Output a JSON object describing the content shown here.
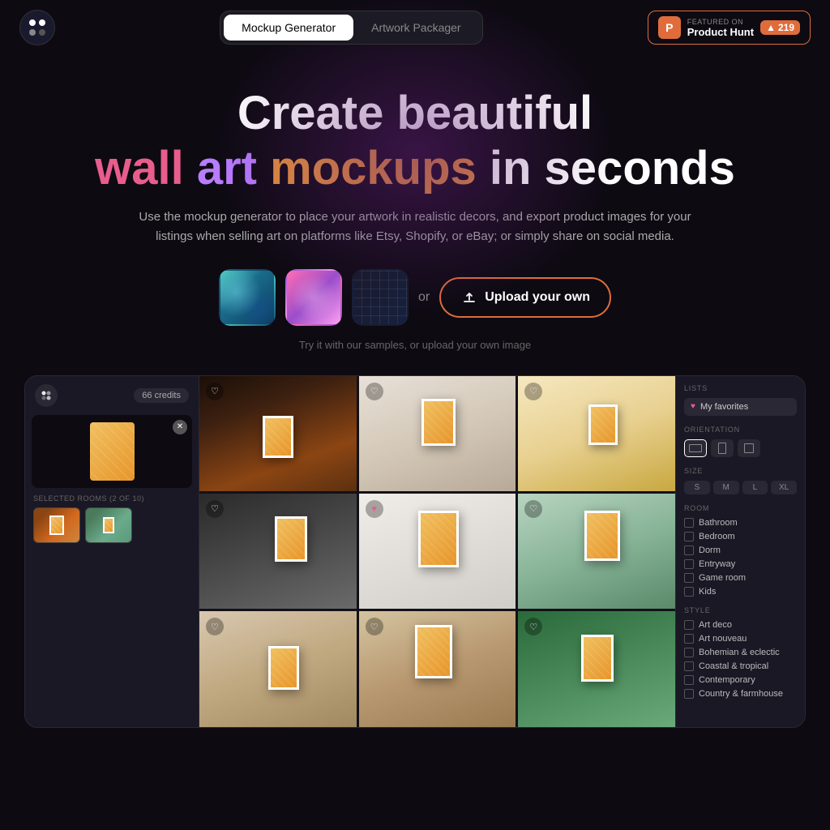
{
  "navbar": {
    "logo_alt": "App logo",
    "tab_mockup": "Mockup Generator",
    "tab_artwork": "Artwork Packager",
    "active_tab": "mockup",
    "ph_featured": "FEATURED ON",
    "ph_name": "Product Hunt",
    "ph_count": "219",
    "ph_arrow": "▲"
  },
  "hero": {
    "title_line1": "Create beautiful",
    "word_wall": "wall",
    "word_art": "art",
    "word_mockups": "mockups",
    "word_in": "in",
    "word_seconds": "seconds",
    "subtitle": "Use the mockup generator to place your artwork in realistic decors, and export product images for your listings when selling art on platforms like Etsy, Shopify, or eBay; or simply share on social media.",
    "or_text": "or",
    "upload_btn": "Upload your own",
    "try_text": "Try it with our samples, or upload your own image"
  },
  "app_preview": {
    "credits": "66 credits",
    "selected_rooms_label": "SELECTED ROOMS (2 OF 10)",
    "filters": {
      "lists_title": "LISTS",
      "my_favorites": "My favorites",
      "orientation_title": "ORIENTATION",
      "size_title": "SIZE",
      "sizes": [
        "S",
        "M",
        "L",
        "XL"
      ],
      "room_title": "ROOM",
      "rooms": [
        "Bathroom",
        "Bedroom",
        "Dorm",
        "Entryway",
        "Game room",
        "Kids"
      ],
      "style_title": "STYLE",
      "styles": [
        "Art deco",
        "Art nouveau",
        "Bohemian & eclectic",
        "Coastal & tropical",
        "Contemporary",
        "Country & farmhouse"
      ]
    }
  }
}
